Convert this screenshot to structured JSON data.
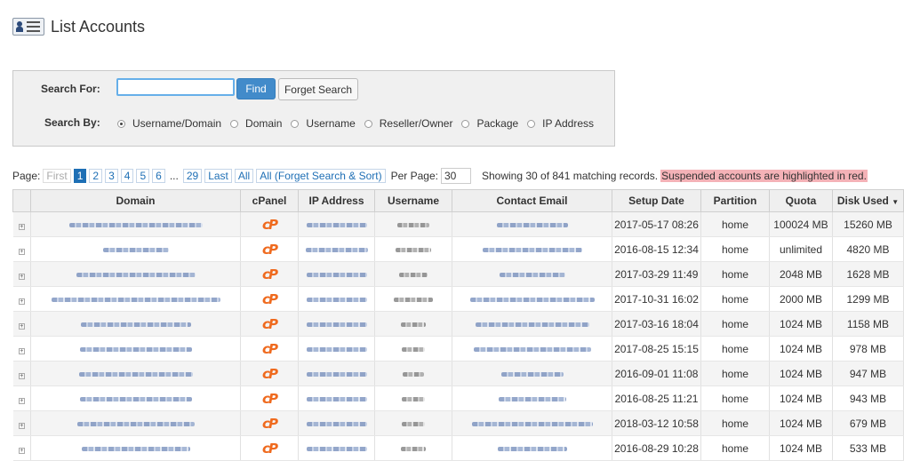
{
  "page": {
    "title": "List Accounts"
  },
  "search": {
    "search_for_label": "Search For:",
    "search_value": "",
    "find_label": "Find",
    "forget_label": "Forget Search",
    "search_by_label": "Search By:",
    "options": [
      "Username/Domain",
      "Domain",
      "Username",
      "Reseller/Owner",
      "Package",
      "IP Address"
    ],
    "selected": "Username/Domain"
  },
  "pager": {
    "page_label": "Page:",
    "first": "First",
    "pages": [
      "1",
      "2",
      "3",
      "4",
      "5",
      "6"
    ],
    "ellipsis": "...",
    "last_page": "29",
    "last": "Last",
    "all": "All",
    "all_forget": "All (Forget Search & Sort)",
    "per_page_label": "Per Page:",
    "per_page_value": "30",
    "showing": "Showing 30 of 841 matching records.",
    "suspended_note": "Suspended accounts are highlighted in red."
  },
  "table": {
    "columns": [
      "Domain",
      "cPanel",
      "IP Address",
      "Username",
      "Contact Email",
      "Setup Date",
      "Partition",
      "Quota",
      "Disk Used"
    ],
    "cpanel_glyph": "cP",
    "expand_glyph": "+",
    "rows": [
      {
        "setup_date": "2017-05-17 08:26",
        "partition": "home",
        "quota": "100024 MB",
        "disk_used": "15260 MB"
      },
      {
        "setup_date": "2016-08-15 12:34",
        "partition": "home",
        "quota": "unlimited",
        "disk_used": "4820 MB"
      },
      {
        "setup_date": "2017-03-29 11:49",
        "partition": "home",
        "quota": "2048 MB",
        "disk_used": "1628 MB"
      },
      {
        "setup_date": "2017-10-31 16:02",
        "partition": "home",
        "quota": "2000 MB",
        "disk_used": "1299 MB"
      },
      {
        "setup_date": "2017-03-16 18:04",
        "partition": "home",
        "quota": "1024 MB",
        "disk_used": "1158 MB"
      },
      {
        "setup_date": "2017-08-25 15:15",
        "partition": "home",
        "quota": "1024 MB",
        "disk_used": "978 MB"
      },
      {
        "setup_date": "2016-09-01 11:08",
        "partition": "home",
        "quota": "1024 MB",
        "disk_used": "947 MB"
      },
      {
        "setup_date": "2016-08-25 11:21",
        "partition": "home",
        "quota": "1024 MB",
        "disk_used": "943 MB"
      },
      {
        "setup_date": "2018-03-12 10:58",
        "partition": "home",
        "quota": "1024 MB",
        "disk_used": "679 MB"
      },
      {
        "setup_date": "2016-08-29 10:28",
        "partition": "home",
        "quota": "1024 MB",
        "disk_used": "533 MB"
      }
    ]
  },
  "colors": {
    "accent": "#428bca",
    "link": "#1e6fb5",
    "suspended": "#f4b2b7",
    "cpanel": "#ef6a1e"
  }
}
